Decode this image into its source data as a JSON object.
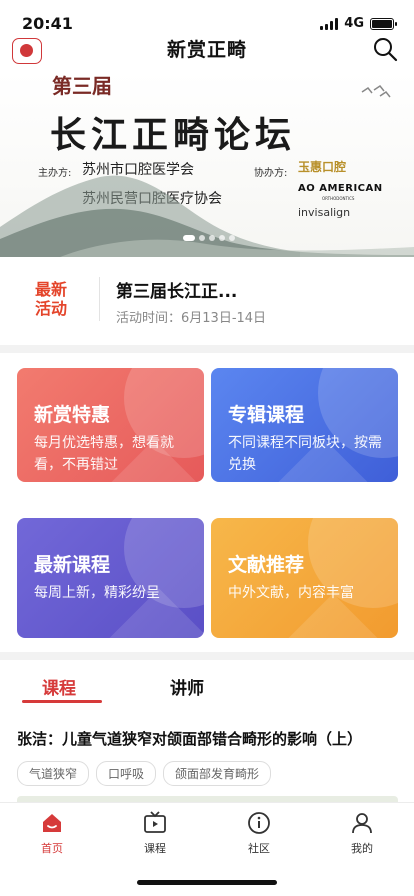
{
  "status_bar": {
    "time": "20:41",
    "network": "4G"
  },
  "nav": {
    "title": "新赏正畸"
  },
  "banner": {
    "subtitle": "第三届",
    "title": "长江正畸论坛",
    "host_label": "主办方:",
    "host_1": "苏州市口腔医学会",
    "host_2": "苏州民营口腔医疗协会",
    "co_label": "协办方:",
    "sponsor_1": "玉惠口腔",
    "sponsor_2": "AO AMERICAN",
    "sponsor_2_sub": "ORTHODONTICS",
    "sponsor_3": "invisalign"
  },
  "news": {
    "tag_line1": "最新",
    "tag_line2": "活动",
    "title": "第三届长江正...",
    "time": "活动时间：6月13日-14日"
  },
  "cards": [
    {
      "title": "新赏特惠",
      "desc": "每月优选特惠，想看就看，不再错过"
    },
    {
      "title": "专辑课程",
      "desc": "不同课程不同板块，按需兑换"
    },
    {
      "title": "最新课程",
      "desc": "每周上新，精彩纷呈"
    },
    {
      "title": "文献推荐",
      "desc": "中外文献，内容丰富"
    }
  ],
  "tabs": {
    "active": "课程",
    "other": "讲师"
  },
  "course": {
    "title": "张洁：儿童气道狭窄对颌面部错合畸形的影响（上）",
    "tags": [
      "气道狭窄",
      "口呼吸",
      "颌面部发育畸形"
    ]
  },
  "tabbar": [
    {
      "label": "首页",
      "icon": "home-icon"
    },
    {
      "label": "课程",
      "icon": "tv-icon"
    },
    {
      "label": "社区",
      "icon": "info-icon"
    },
    {
      "label": "我的",
      "icon": "user-icon"
    }
  ],
  "colors": {
    "accent": "#d63a3a"
  }
}
